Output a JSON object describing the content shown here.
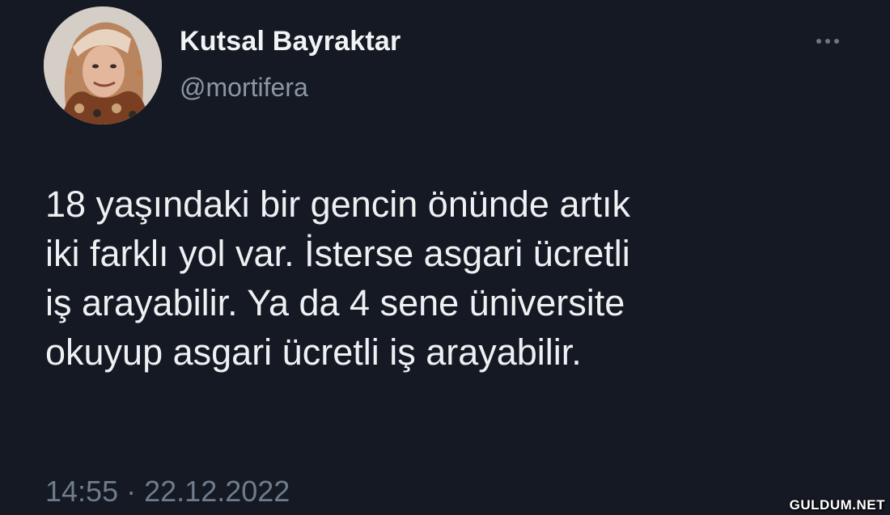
{
  "author": {
    "display_name": "Kutsal Bayraktar",
    "handle": "@mortifera",
    "avatar_icon": "profile-photo"
  },
  "tweet": {
    "text": "18 yaşındaki bir gencin önünde artık\niki farklı yol var. İsterse asgari ücretli\niş arayabilir. Ya da 4 sene üniversite\nokuyup asgari ücretli iş arayabilir.",
    "time": "14:55",
    "separator": "·",
    "date": "22.12.2022"
  },
  "more_menu_icon": "more-horizontal-icon",
  "watermark": "GULDUM.NET",
  "colors": {
    "background": "#151923",
    "primary_text": "#eef0f2",
    "secondary_text": "#8b98a5",
    "meta_text": "#6e7c8b"
  }
}
